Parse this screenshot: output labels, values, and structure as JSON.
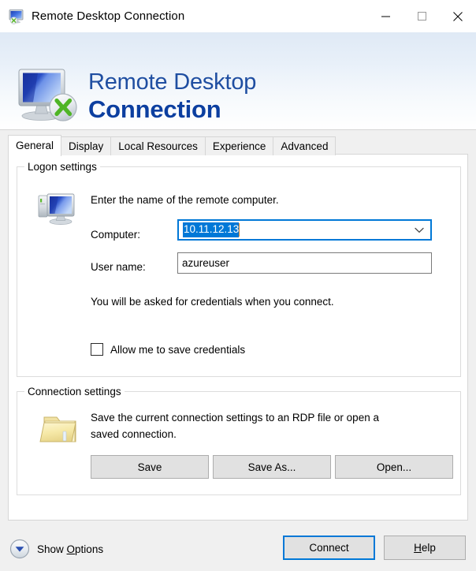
{
  "window": {
    "title": "Remote Desktop Connection",
    "icon": "remote-desktop-icon",
    "controls": {
      "minimize": "minimize-icon",
      "maximize": "maximize-icon",
      "close": "close-icon"
    }
  },
  "banner": {
    "line1": "Remote Desktop",
    "line2": "Connection",
    "logo": "remote-desktop-logo",
    "accent_color": "#1f4ea1"
  },
  "tabs": [
    {
      "label": "General",
      "selected": true
    },
    {
      "label": "Display",
      "selected": false
    },
    {
      "label": "Local Resources",
      "selected": false
    },
    {
      "label": "Experience",
      "selected": false
    },
    {
      "label": "Advanced",
      "selected": false
    }
  ],
  "logon_settings": {
    "group_title": "Logon settings",
    "icon": "computer-icon",
    "description": "Enter the name of the remote computer.",
    "computer_label": "Computer:",
    "computer_value": "10.11.12.13",
    "computer_selected": true,
    "username_label": "User name:",
    "username_value": "azureuser",
    "credentials_note": "You will be asked for credentials when you connect.",
    "checkbox_label": "Allow me to save credentials",
    "checkbox_checked": false
  },
  "connection_settings": {
    "group_title": "Connection settings",
    "icon": "folder-icon",
    "description_line1": "Save the current connection settings to an RDP file or open a",
    "description_line2": "saved connection.",
    "save_label": "Save",
    "save_as_label": "Save As...",
    "open_label": "Open..."
  },
  "footer": {
    "show_options_label_pre": "Show ",
    "show_options_accel": "O",
    "show_options_label_post": "ptions",
    "show_options_icon": "chevron-down-icon",
    "connect_label": "Connect",
    "help_label_pre": "",
    "help_accel": "H",
    "help_label_post": "elp"
  },
  "colors": {
    "accent": "#0078d7",
    "dialog_bg": "#f0f0f0",
    "panel_bg": "#ffffff",
    "title_blue": "#1f4ea1"
  }
}
